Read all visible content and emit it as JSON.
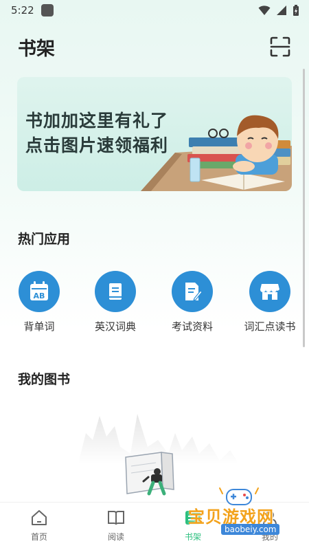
{
  "status_bar": {
    "time": "5:22"
  },
  "header": {
    "title": "书架"
  },
  "banner": {
    "line1": "书加加这里有礼了",
    "line2": "点击图片速领福利"
  },
  "hot_apps": {
    "title": "热门应用",
    "items": [
      {
        "label": "背单词",
        "icon": "calendar-ab-icon"
      },
      {
        "label": "英汉词典",
        "icon": "book-icon"
      },
      {
        "label": "考试资料",
        "icon": "document-edit-icon"
      },
      {
        "label": "词汇点读书",
        "icon": "store-icon"
      }
    ]
  },
  "my_books": {
    "title": "我的图书"
  },
  "bottom_nav": {
    "items": [
      {
        "label": "首页",
        "icon": "home-icon"
      },
      {
        "label": "阅读",
        "icon": "open-book-icon"
      },
      {
        "label": "书架",
        "icon": "bookshelf-icon",
        "active": true
      },
      {
        "label": "我的",
        "icon": "profile-icon"
      }
    ],
    "active_color": "#2bbf7e"
  },
  "watermark": {
    "title": "宝贝游戏网",
    "url": "baobeiy.com"
  },
  "colors": {
    "accent_blue": "#2d8fd6",
    "accent_green": "#2bbf7e"
  }
}
